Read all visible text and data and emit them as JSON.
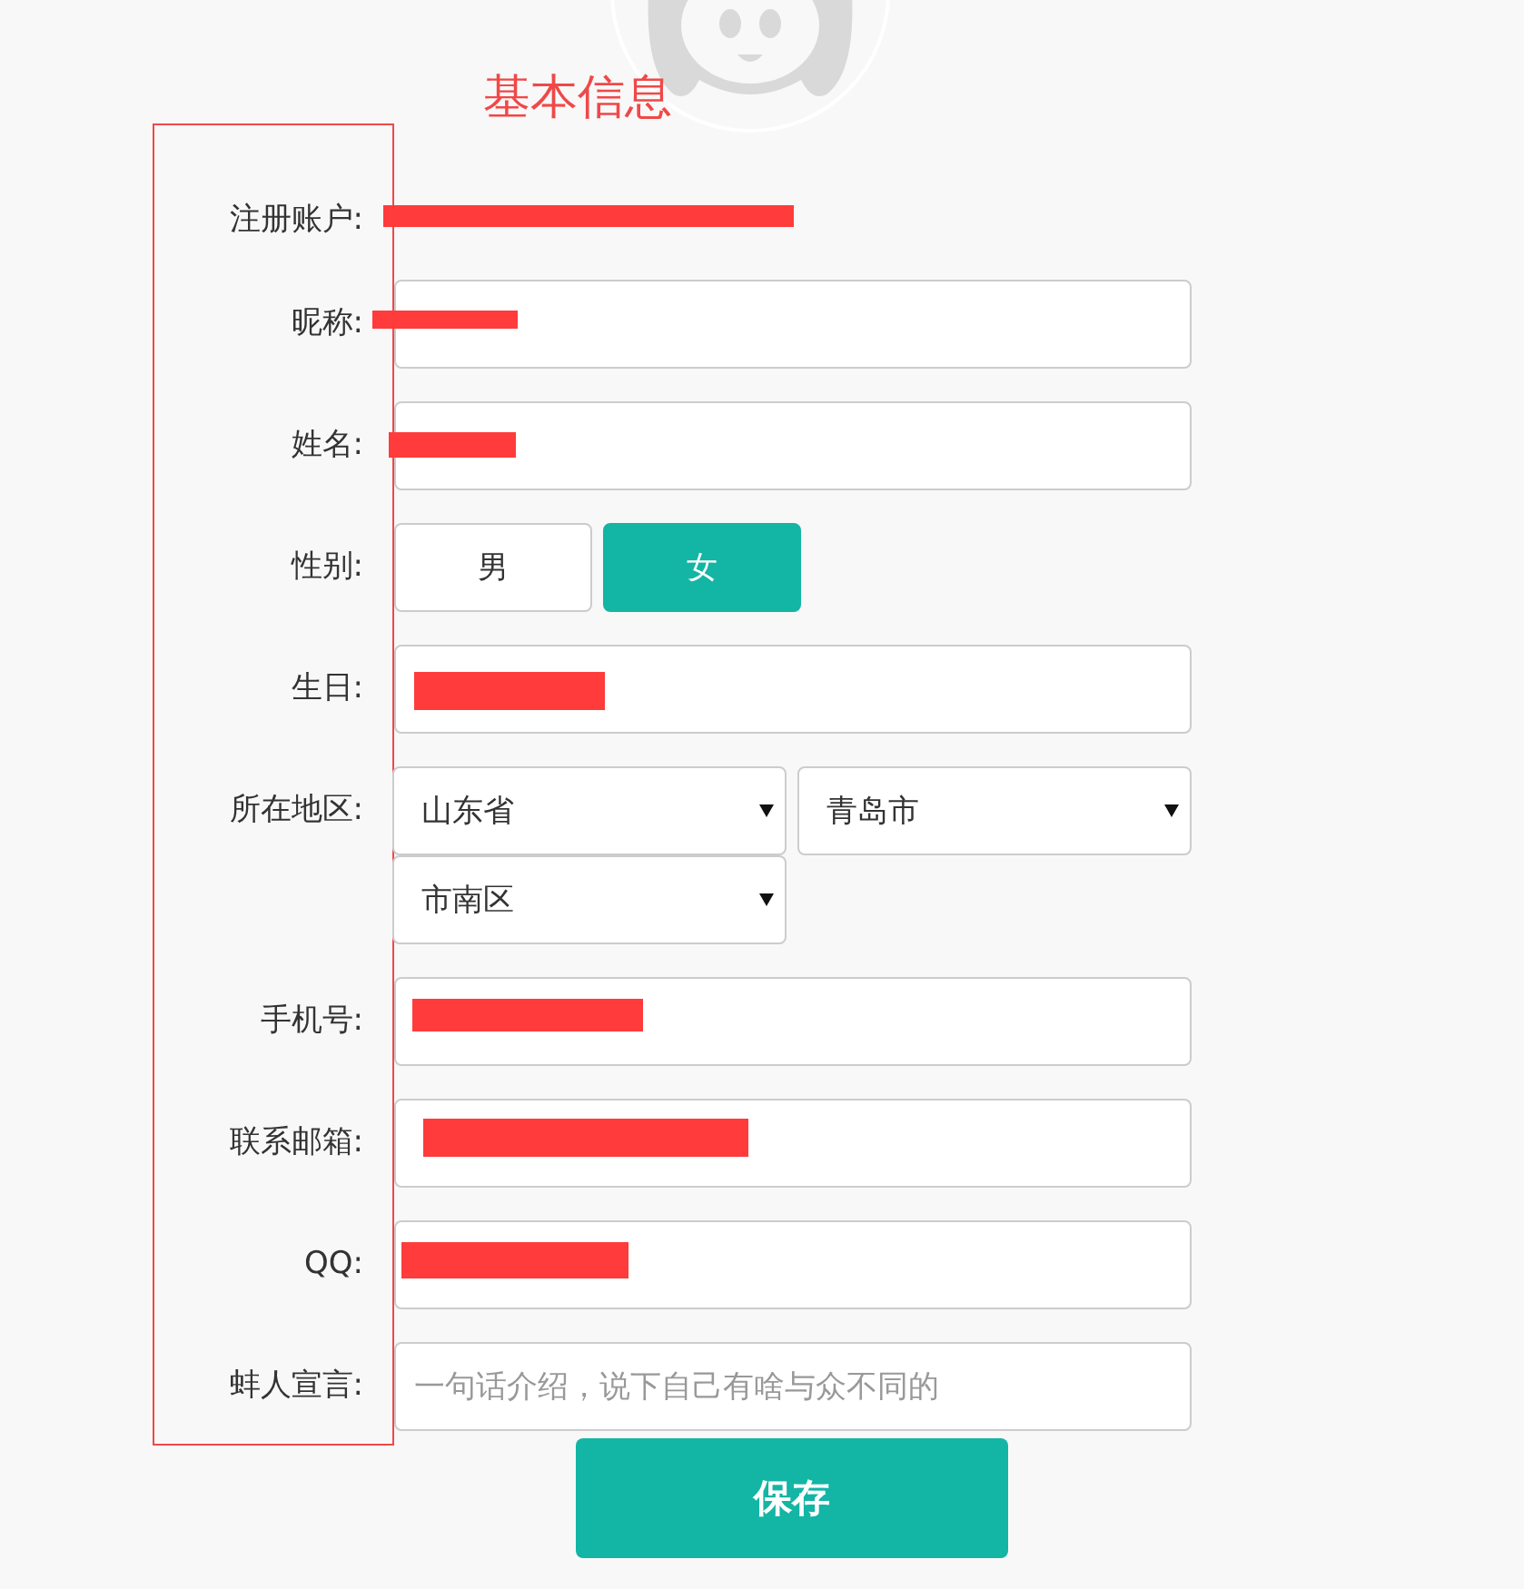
{
  "section_title": "基本信息",
  "rows": [
    {
      "kind": "text",
      "label": "注册账户:",
      "redacted": true
    },
    {
      "kind": "input",
      "label": "昵称:",
      "redacted": true
    },
    {
      "kind": "input",
      "label": "姓名:",
      "redacted": true
    },
    {
      "kind": "gender",
      "label": "性别:",
      "options": [
        {
          "label": "男",
          "selected": false
        },
        {
          "label": "女",
          "selected": true
        }
      ]
    },
    {
      "kind": "input",
      "label": "生日:",
      "redacted": true
    },
    {
      "kind": "region",
      "label": "所在地区:",
      "selects": [
        "山东省",
        "青岛市",
        "市南区"
      ]
    },
    {
      "kind": "input",
      "label": "手机号:",
      "redacted": true
    },
    {
      "kind": "input",
      "label": "联系邮箱:",
      "redacted": true
    },
    {
      "kind": "input",
      "label": "QQ:",
      "redacted": true
    },
    {
      "kind": "input",
      "label": "蚌人宣言:",
      "placeholder": "一句话介绍，说下自己有啥与众不同的",
      "redacted": false
    }
  ],
  "save_button": "保存"
}
